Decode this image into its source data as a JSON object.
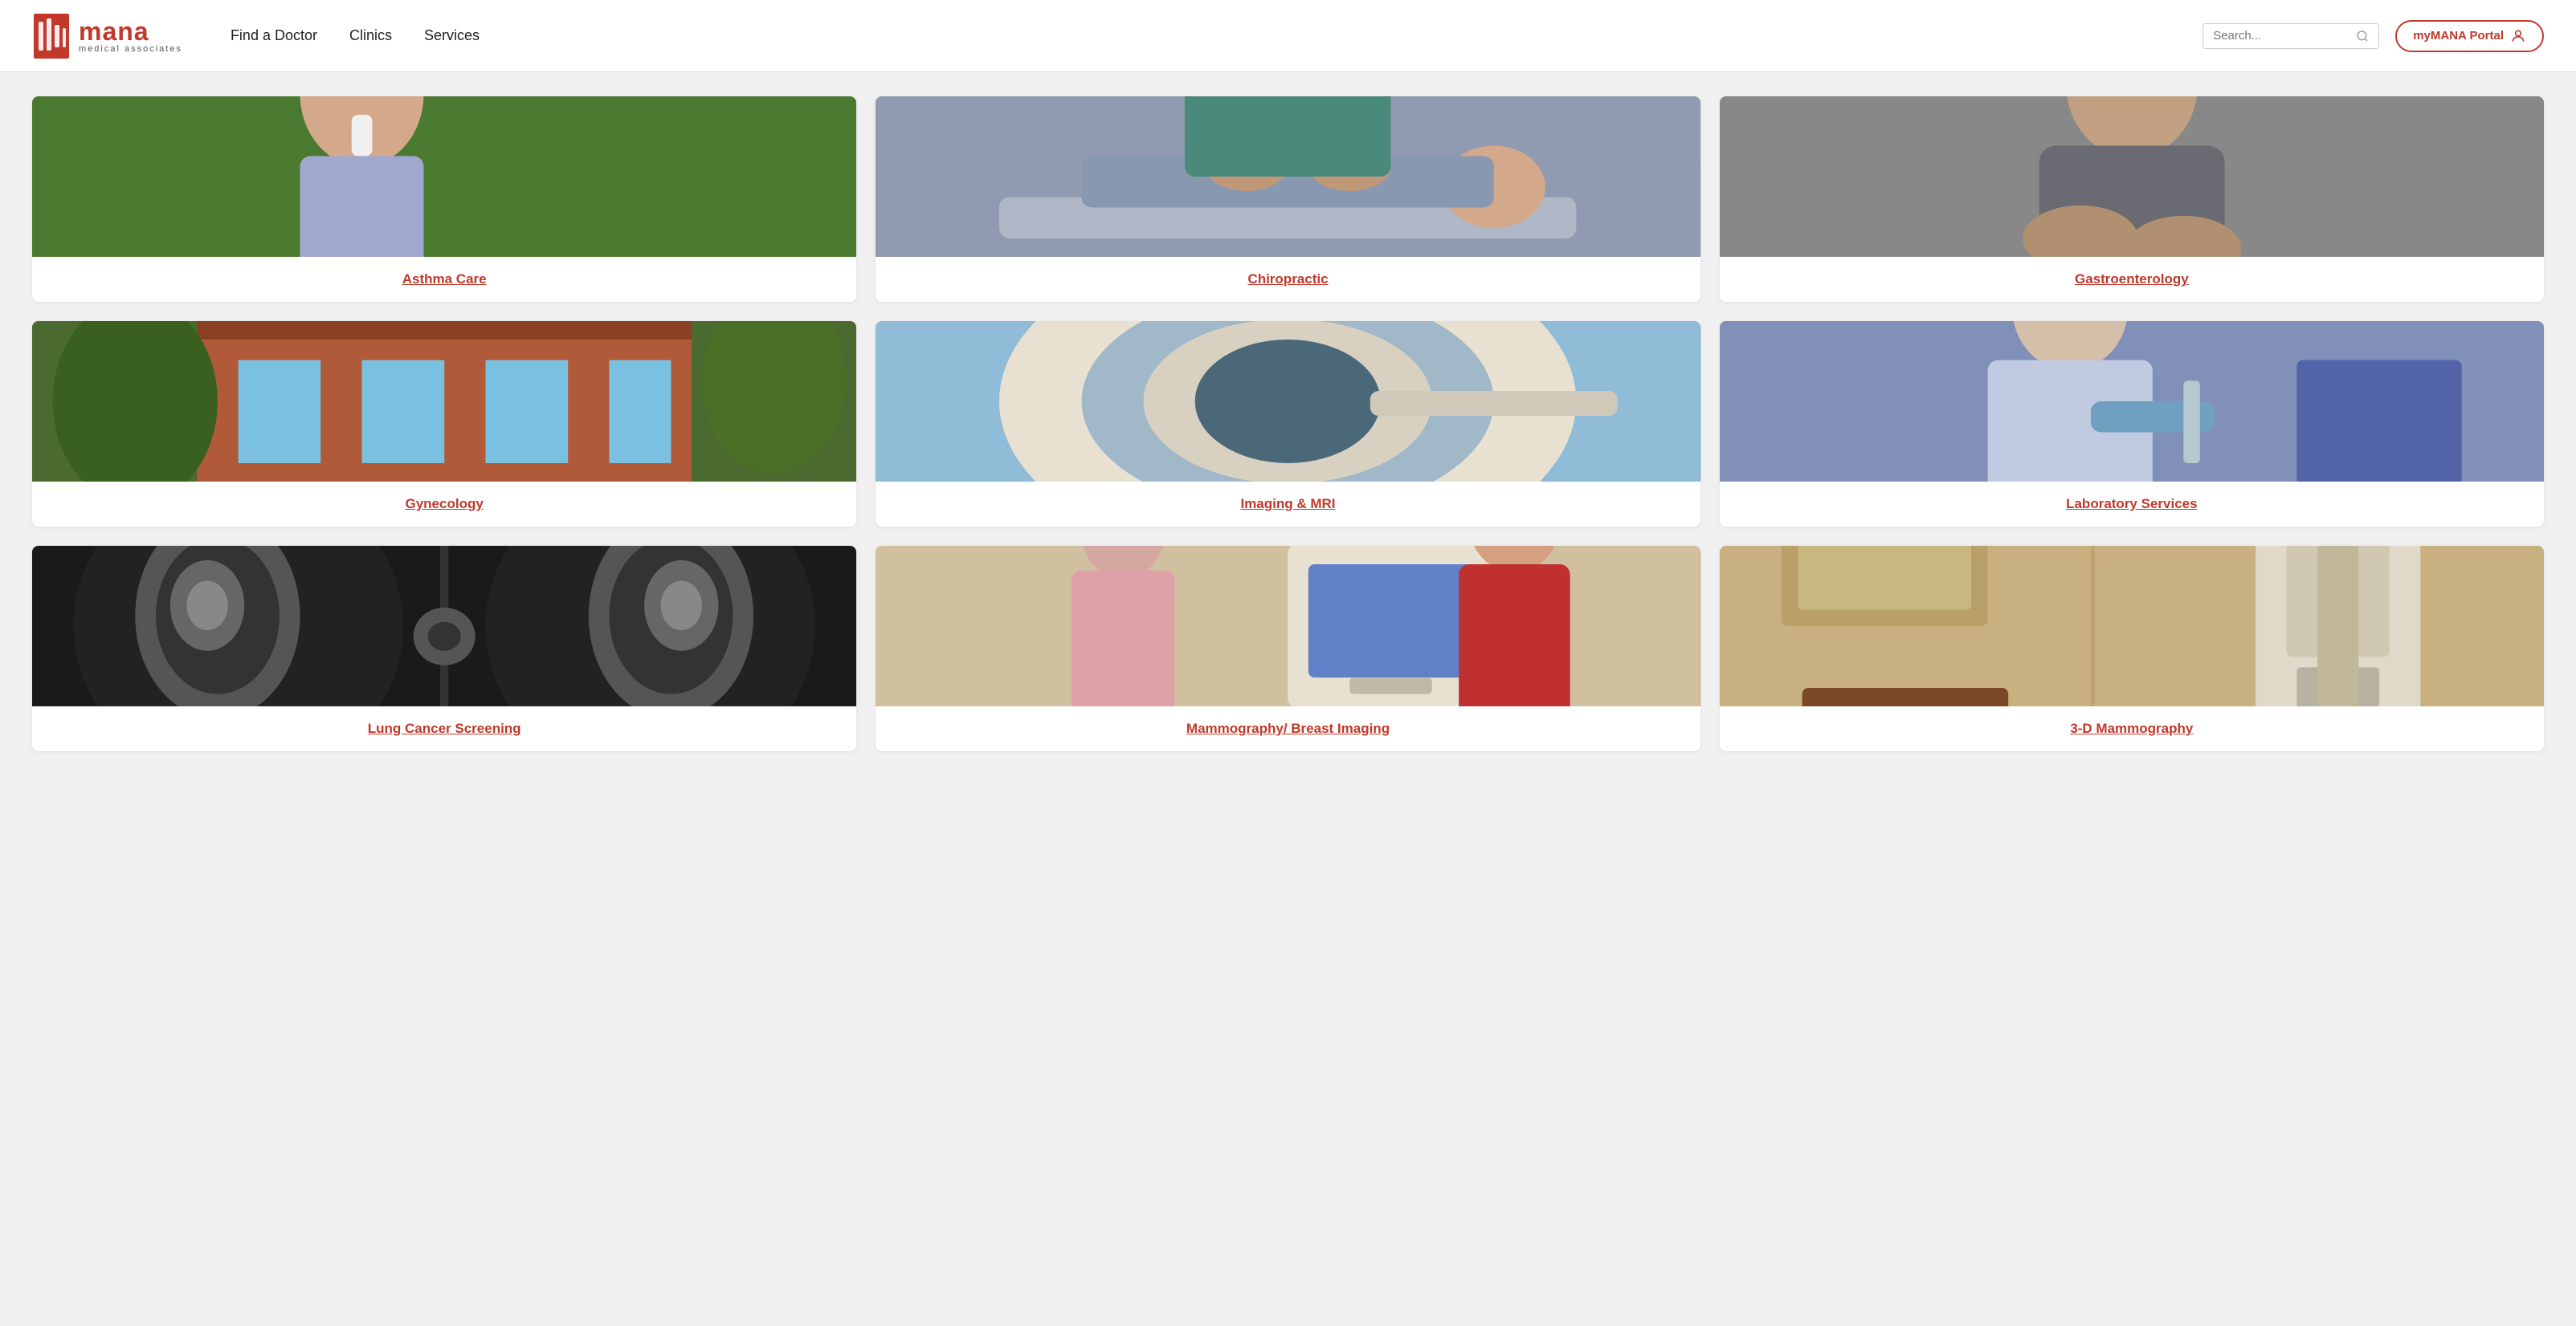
{
  "header": {
    "logo": {
      "brand": "mana",
      "sub": "medical associates"
    },
    "nav": [
      {
        "label": "Find a Doctor",
        "id": "find-doctor"
      },
      {
        "label": "Clinics",
        "id": "clinics"
      },
      {
        "label": "Services",
        "id": "services"
      }
    ],
    "search": {
      "placeholder": "Search..."
    },
    "portal": {
      "label": "myMANA Portal"
    }
  },
  "services": [
    {
      "id": "asthma-care",
      "label": "Asthma Care",
      "img_class": "img-asthma",
      "img_desc": "Woman using inhaler outdoors"
    },
    {
      "id": "chiropractic",
      "label": "Chiropractic",
      "img_class": "img-chiro",
      "img_desc": "Chiropractor treating patient's back"
    },
    {
      "id": "gastroenterology",
      "label": "Gastroenterology",
      "img_class": "img-gastro",
      "img_desc": "Person holding abdomen"
    },
    {
      "id": "gynecology",
      "label": "Gynecology",
      "img_class": "img-gynecology",
      "img_desc": "Renaissance Women's Healthcare building exterior"
    },
    {
      "id": "imaging-mri",
      "label": "Imaging & MRI",
      "img_class": "img-imaging",
      "img_desc": "MRI machine in clinical setting"
    },
    {
      "id": "laboratory-services",
      "label": "Laboratory Services",
      "img_class": "img-lab",
      "img_desc": "Lab technician working with samples"
    },
    {
      "id": "lung-cancer-screening",
      "label": "Lung Cancer Screening",
      "img_class": "img-lung",
      "img_desc": "CT scan images of lungs"
    },
    {
      "id": "mammography-breast-imaging",
      "label": "Mammography/ Breast Imaging",
      "img_class": "img-mammo",
      "img_desc": "Medical staff at imaging workstation"
    },
    {
      "id": "3d-mammography",
      "label": "3-D Mammography",
      "img_class": "img-mammo3d",
      "img_desc": "Mammography equipment in exam room"
    }
  ]
}
